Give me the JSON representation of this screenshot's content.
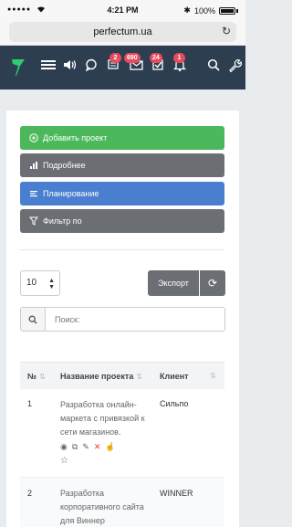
{
  "status_bar": {
    "time": "4:21 PM",
    "battery": "100%"
  },
  "browser": {
    "url": "perfectum.ua"
  },
  "topbar": {
    "badges": {
      "messages": "2",
      "mail": "690",
      "tasks": "24",
      "notifications": "1"
    }
  },
  "actions": {
    "add_project": "Добавить проект",
    "details": "Подробнее",
    "planning": "Планирование",
    "filter": "Фильтр по"
  },
  "controls": {
    "page_size": "10",
    "export_label": "Экспорт",
    "search_placeholder": "Поиск:"
  },
  "table": {
    "columns": [
      "№",
      "Название проекта",
      "Клиент"
    ],
    "rows": [
      {
        "num": "1",
        "name": "Разработка онлайн-маркета с привязкой к сети магазинов.",
        "client": "Сильпо"
      },
      {
        "num": "2",
        "name": "Разработка корпоративного сайта для Виннер",
        "client": "WINNER"
      }
    ]
  },
  "colors": {
    "topbar": "#2c3e50",
    "success": "#4cb85c",
    "secondary": "#6b6f73",
    "primary": "#4a7fcf",
    "badge": "#e74c5c"
  }
}
